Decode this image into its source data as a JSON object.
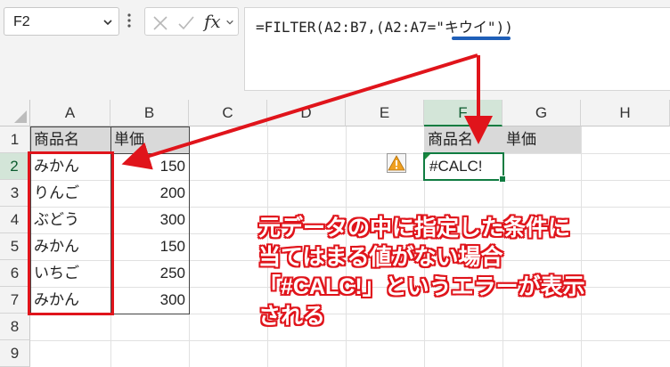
{
  "name_box": {
    "value": "F2"
  },
  "formula_bar": {
    "fx": "fx",
    "formula_prefix": "=FILTER(A2:B7,(A2:A7=",
    "formula_highlight": "\"キウイ\"",
    "formula_suffix": "))"
  },
  "columns": [
    "A",
    "B",
    "C",
    "D",
    "E",
    "F",
    "G",
    "H"
  ],
  "rows": [
    "1",
    "2",
    "3",
    "4",
    "5",
    "6",
    "7",
    "8",
    "9"
  ],
  "table": {
    "headers": [
      "商品名",
      "単価"
    ],
    "rows": [
      [
        "みかん",
        "150"
      ],
      [
        "りんご",
        "200"
      ],
      [
        "ぶどう",
        "300"
      ],
      [
        "みかん",
        "150"
      ],
      [
        "いちご",
        "250"
      ],
      [
        "みかん",
        "300"
      ]
    ]
  },
  "result": {
    "headers": [
      "商品名",
      "単価"
    ],
    "error": "#CALC!"
  },
  "annotation": {
    "lines": [
      "元データの中に指定した条件に",
      "当てはまる値がない場合",
      "「#CALC!」というエラーが表示",
      "される"
    ]
  },
  "colors": {
    "accent_red": "#e0141b",
    "excel_green": "#107c41",
    "underline_blue": "#1f5fb8"
  }
}
